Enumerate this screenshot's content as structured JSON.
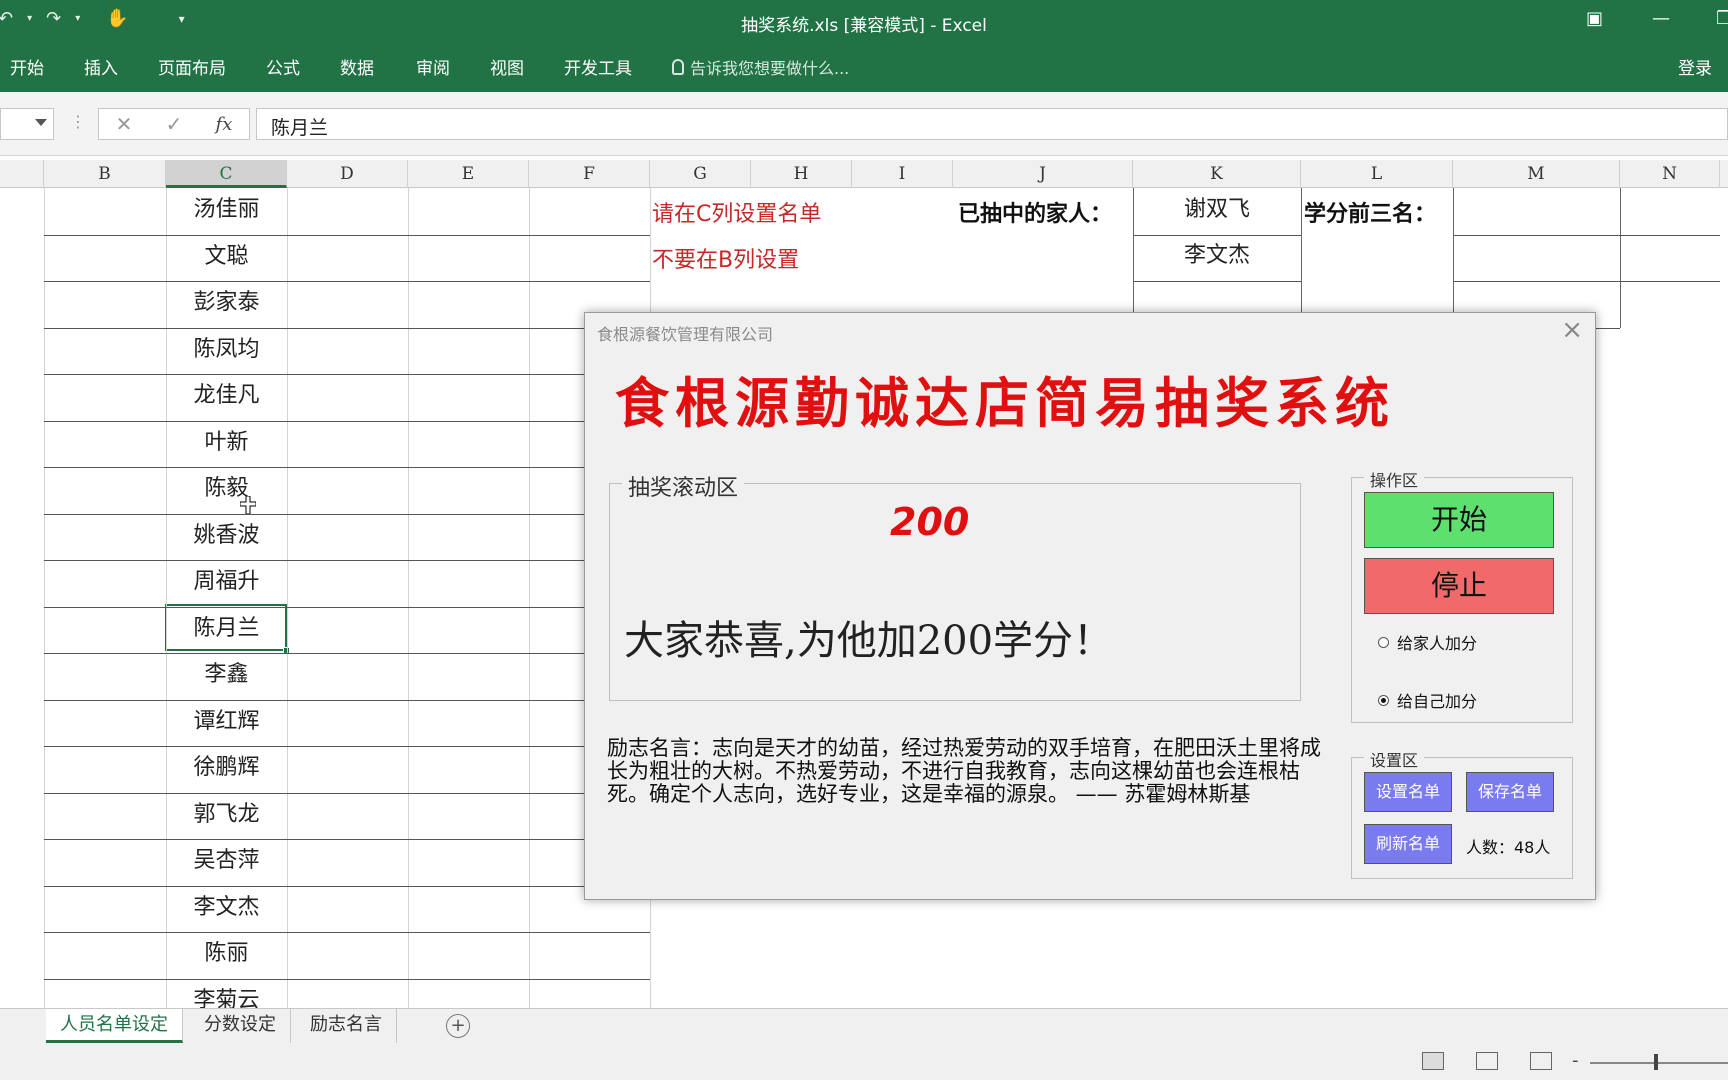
{
  "window": {
    "title": "抽奖系统.xls  [兼容模式] - Excel"
  },
  "ribbon": {
    "tabs": [
      "开始",
      "插入",
      "页面布局",
      "公式",
      "数据",
      "审阅",
      "视图",
      "开发工具"
    ],
    "tell_me": "告诉我您想要做什么...",
    "login": "登录"
  },
  "formula_bar": {
    "content": "陈月兰"
  },
  "columns": [
    "B",
    "C",
    "D",
    "E",
    "F",
    "G",
    "H",
    "I",
    "J",
    "K",
    "L",
    "M",
    "N"
  ],
  "active_column": "C",
  "names_column_c": [
    "汤佳丽",
    "文聪",
    "彭家泰",
    "陈凤均",
    "龙佳凡",
    "叶新",
    "陈毅",
    "姚香波",
    "周福升",
    "陈月兰",
    "李鑫",
    "谭红辉",
    "徐鹏辉",
    "郭飞龙",
    "吴杏萍",
    "李文杰",
    "陈丽",
    "李菊云"
  ],
  "notes": {
    "note1": "请在C列设置名单",
    "note2": "不要在B列设置",
    "drawn_label": "已抽中的家人：",
    "drawn": [
      "谢双飞",
      "李文杰"
    ],
    "top3_label": "学分前三名："
  },
  "sheets": {
    "tabs": [
      "人员名单设定",
      "分数设定",
      "励志名言"
    ],
    "active": "人员名单设定"
  },
  "dialog": {
    "window_title": "食根源餐饮管理有限公司",
    "heading": "食根源勤诚达店简易抽奖系统",
    "rolling_area_label": "抽奖滚动区",
    "score": "200",
    "message": "大家恭喜,为他加200学分！",
    "quote": "励志名言：志向是天才的幼苗，经过热爱劳动的双手培育，在肥田沃土里将成长为粗壮的大树。不热爱劳动，不进行自我教育，志向这棵幼苗也会连根枯死。确定个人志向，选好专业，这是幸福的源泉。 —— 苏霍姆林斯基",
    "ops_label": "操作区",
    "start_label": "开始",
    "stop_label": "停止",
    "radio_family": "给家人加分",
    "radio_self": "给自己加分",
    "radio_selected": "给自己加分",
    "settings_label": "设置区",
    "set_list_label": "设置名单",
    "save_list_label": "保存名单",
    "refresh_list_label": "刷新名单",
    "count_text": "人数：48人"
  },
  "colors": {
    "excel_green": "#217346",
    "accent_red": "#e01010",
    "start_green": "#5ee06e",
    "stop_red": "#f06a6a",
    "button_blue": "#7b7bf0"
  }
}
